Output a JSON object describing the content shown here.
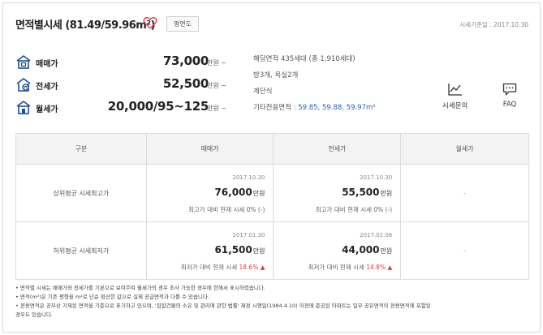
{
  "header": {
    "title": "면적별시세 (81.49/59.96m²)",
    "plan_button": "평면도",
    "base_date": "시세기준일 : 2017.10.30"
  },
  "prices": [
    {
      "icon": "house-sale-icon",
      "label": "매매가",
      "value": "73,000",
      "unit": "만원 ~"
    },
    {
      "icon": "house-lease-icon",
      "label": "전세가",
      "value": "52,500",
      "unit": "만원 ~"
    },
    {
      "icon": "house-rent-icon",
      "label": "월세가",
      "value": "20,000/95~125",
      "unit": "만원 ~"
    }
  ],
  "info": {
    "households": "해당면적 435세대 (총 1,910세대)",
    "rooms": "방3개, 욕실2개",
    "structure": "계단식",
    "other_area_label": "기타전용면적 : ",
    "other_area_values": "59.85, 59.88, 59.97m²"
  },
  "tools": {
    "inquiry": "시세문의",
    "faq": "FAQ"
  },
  "table": {
    "headers": [
      "구분",
      "매매가",
      "전세가",
      "월세가"
    ],
    "rows": [
      {
        "label": "상위평균 시세최고가",
        "sale": {
          "date": "2017.10.30",
          "value": "76,000",
          "unit": "만원",
          "note": "최고가 대비 현재 시세 0% (-)",
          "change": ""
        },
        "lease": {
          "date": "2017.10.30",
          "value": "55,500",
          "unit": "만원",
          "note": "최고가 대비 현재 시세 0% (-)",
          "change": ""
        },
        "rent": "-"
      },
      {
        "label": "하위평균 시세최저가",
        "sale": {
          "date": "2017.01.30",
          "value": "61,500",
          "unit": "만원",
          "note": "최저가 대비 현재 시세 ",
          "change": "18.6% ▲"
        },
        "lease": {
          "date": "2017.02.06",
          "value": "44,000",
          "unit": "만원",
          "note": "최저가 대비 현재 시세 ",
          "change": "14.8% ▲"
        },
        "rent": "-"
      }
    ]
  },
  "notes": [
    "• 면적별 시세는 매매가와 전세가를 기본으로 보여주며 월세가의 경우 조사 가능한 경우에 한해서 표시하였습니다.",
    "• 면적(m²)은 기존 평형을 m²로 단순 환산한 값으로 실제 공급면적과 다를 수 있습니다.",
    "• 전용면적은 공부상 기재된 면적을 기준으로 표기하고 있으며, '집합건물의 소유 및 관리에 관한 법률' 제정 시행일(1984.4.10) 이전에 준공된 아파트는 일부 공유면적이 전용면적에 포함된",
    "  경우도 있습니다."
  ],
  "colors": {
    "accent": "#d43f3f",
    "link": "#2f5fb7",
    "icon": "#1e4f8f"
  }
}
